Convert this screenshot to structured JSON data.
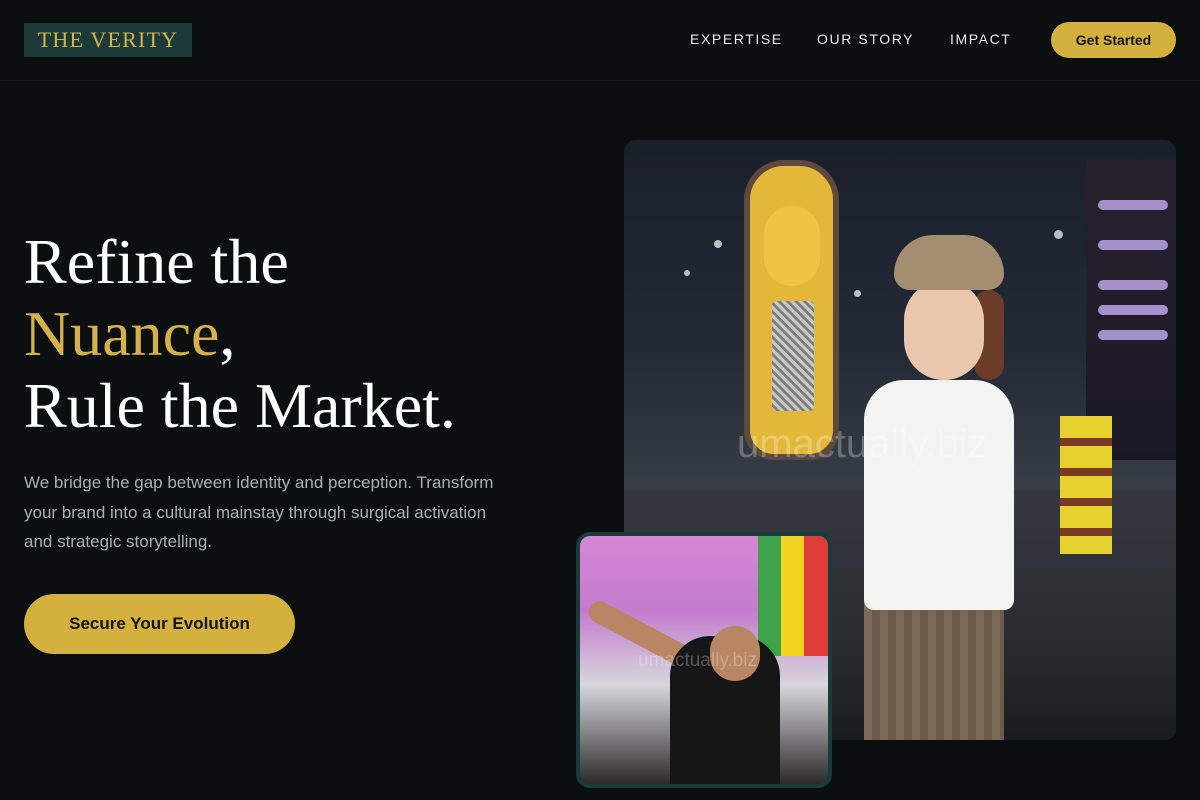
{
  "header": {
    "logo": "THE VERITY",
    "nav": [
      {
        "label": "EXPERTISE"
      },
      {
        "label": "OUR STORY"
      },
      {
        "label": "IMPACT"
      }
    ],
    "cta_label": "Get Started"
  },
  "hero": {
    "headline_line1": "Refine the",
    "headline_accent": "Nuance",
    "headline_comma": ",",
    "headline_line3": "Rule the Market.",
    "subtext": "We bridge the gap between identity and perception. Transform your brand into a cultural mainstay through surgical activation and strategic storytelling.",
    "cta_label": "Secure Your Evolution"
  },
  "images": {
    "main_watermark": "umactually.biz",
    "inset_watermark": "umactually.biz"
  },
  "colors": {
    "background": "#0b0f10",
    "accent": "#d4b14a",
    "logo_bg": "#1c3a38"
  }
}
